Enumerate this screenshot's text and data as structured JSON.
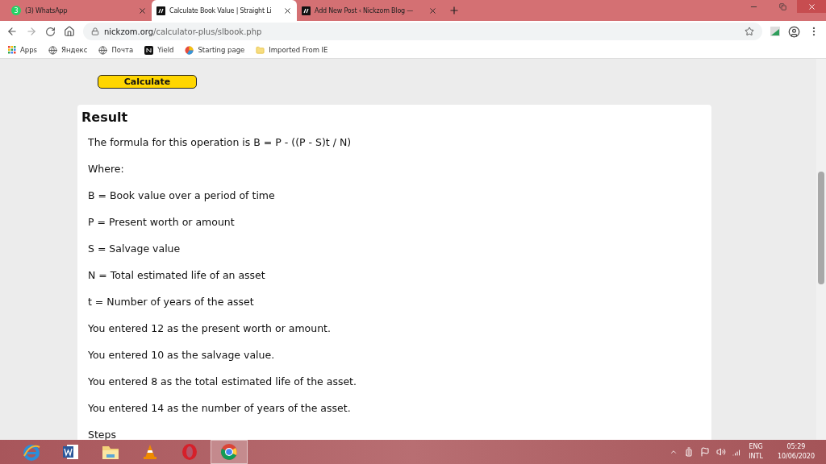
{
  "tabs": [
    {
      "title": "(3) WhatsApp",
      "badge": "3",
      "selected": false
    },
    {
      "title": "Calculate Book Value | Straight Li",
      "selected": true
    },
    {
      "title": "Add New Post ‹ Nickzom Blog —",
      "selected": false
    }
  ],
  "address_bar": {
    "domain": "nickzom.org",
    "path": "/calculator-plus/slbook.php"
  },
  "bookmarks": [
    {
      "label": "Apps"
    },
    {
      "label": "Яндекс"
    },
    {
      "label": "Почта"
    },
    {
      "label": "Yield"
    },
    {
      "label": "Starting page"
    },
    {
      "label": "Imported From IE"
    }
  ],
  "page": {
    "button": "Calculate",
    "result_title": "Result",
    "lines": [
      "The formula for this operation is B = P - ((P - S)t / N)",
      "Where:",
      "B = Book value over a period of time",
      "P = Present worth or amount",
      "S = Salvage value",
      "N = Total estimated life of an asset",
      "t = Number of years of the asset",
      "You entered 12 as the present worth or amount.",
      "You entered 10 as the salvage value.",
      "You entered 8 as the total estimated life of the asset.",
      "You entered 14 as the number of years of the asset.",
      "Steps"
    ]
  },
  "taskbar": {
    "apps": [
      {
        "selected": false
      },
      {
        "selected": false
      },
      {
        "selected": false
      },
      {
        "selected": false
      },
      {
        "selected": false
      },
      {
        "selected": true
      }
    ],
    "language": "ENG",
    "layout": "INTL",
    "time": "05:29",
    "date": "10/06/2020"
  }
}
